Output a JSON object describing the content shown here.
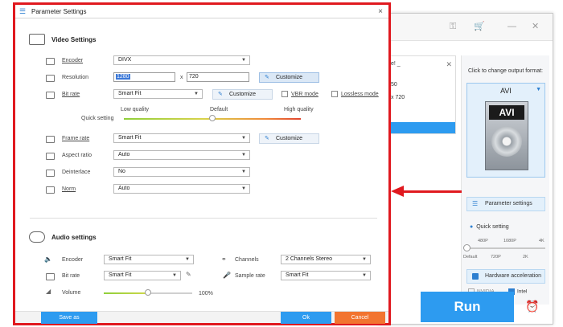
{
  "dialog": {
    "title": "Parameter Settings",
    "close_glyph": "×",
    "video": {
      "heading": "Video Settings",
      "encoder_label": "Encoder",
      "encoder_value": "DIVX",
      "resolution_label": "Resolution",
      "res_width": "1280",
      "res_x": "x",
      "res_height": "720",
      "customize_label": "Customize",
      "bitrate_label": "Bit rate",
      "bitrate_value": "Smart Fit",
      "vbr_label": "VBR mode",
      "lossless_label": "Lossless mode",
      "quick_setting_label": "Quick setting",
      "quality_low": "Low quality",
      "quality_default": "Default",
      "quality_high": "High quality",
      "quality_level_fraction": 0.5,
      "framerate_label": "Frame rate",
      "framerate_value": "Smart Fit",
      "aspect_label": "Aspect ratio",
      "aspect_value": "Auto",
      "deinterlace_label": "Deinterlace",
      "deinterlace_value": "No",
      "norm_label": "Norm",
      "norm_value": "Auto"
    },
    "audio": {
      "heading": "Audio settings",
      "encoder_label": "Encoder",
      "encoder_value": "Smart Fit",
      "bitrate_label": "Bit rate",
      "bitrate_value": "Smart Fit",
      "volume_label": "Volume",
      "volume_value": "100%",
      "volume_fraction": 0.5,
      "channels_label": "Channels",
      "channels_value": "2 Channels Stereo",
      "samplerate_label": "Sample rate",
      "samplerate_value": "Smart Fit"
    },
    "footer": {
      "save_as": "Save as",
      "ok": "Ok",
      "cancel": "Cancel"
    }
  },
  "main_window": {
    "file_fragment_1": "e! _",
    "file_fragment_2": "50",
    "file_fragment_3": "x 720",
    "output_hint": "Click to change output format:",
    "format_name": "AVI",
    "format_art_label": "AVI",
    "parameter_settings_button": "Parameter settings",
    "quick_setting_label": "Quick setting",
    "qs_top_labels": [
      "480P",
      "1080P",
      "4K"
    ],
    "qs_bottom_labels": [
      "Default",
      "720P",
      "2K"
    ],
    "hardware_accel_label": "Hardware acceleration",
    "nvidia_label": "NVIDIA",
    "intel_label": "Intel",
    "run_label": "Run"
  },
  "colors": {
    "accent_blue": "#2d9bf0",
    "cancel_orange": "#f27430",
    "highlight_red": "#e0191f"
  }
}
